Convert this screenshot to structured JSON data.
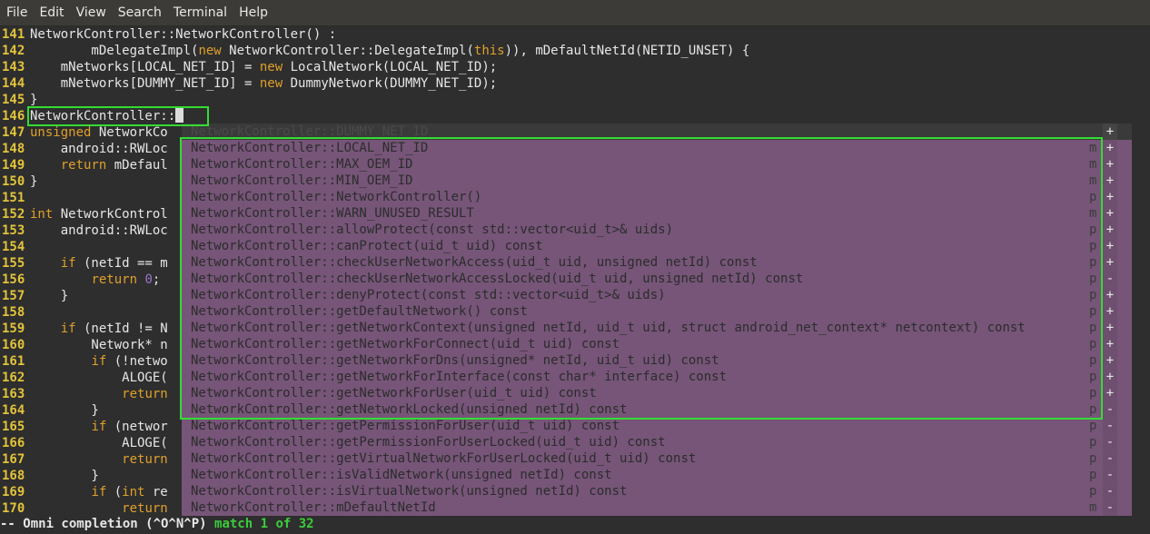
{
  "menubar": [
    "File",
    "Edit",
    "View",
    "Search",
    "Terminal",
    "Help"
  ],
  "lines": [
    {
      "n": "141",
      "segs": [
        {
          "t": "NetworkController::NetworkController() :"
        }
      ]
    },
    {
      "n": "142",
      "segs": [
        {
          "t": "        mDelegateImpl("
        },
        {
          "t": "new",
          "c": "kw"
        },
        {
          "t": " NetworkController::DelegateImpl("
        },
        {
          "t": "this",
          "c": "kw"
        },
        {
          "t": ")), mDefaultNetId(NETID_UNSET) {"
        }
      ]
    },
    {
      "n": "143",
      "segs": [
        {
          "t": "    mNetworks[LOCAL_NET_ID] = "
        },
        {
          "t": "new",
          "c": "kw"
        },
        {
          "t": " LocalNetwork(LOCAL_NET_ID);"
        }
      ]
    },
    {
      "n": "144",
      "segs": [
        {
          "t": "    mNetworks[DUMMY_NET_ID] = "
        },
        {
          "t": "new",
          "c": "kw"
        },
        {
          "t": " DummyNetwork(DUMMY_NET_ID);"
        }
      ]
    },
    {
      "n": "145",
      "segs": [
        {
          "t": "}"
        }
      ]
    },
    {
      "n": "146",
      "segs": [
        {
          "t": "NetworkController::"
        }
      ],
      "cursor": true
    },
    {
      "n": "147",
      "segs": [
        {
          "t": "unsigned",
          "c": "kw"
        },
        {
          "t": " NetworkCo"
        }
      ]
    },
    {
      "n": "148",
      "segs": [
        {
          "t": "    android::RWLoc"
        }
      ]
    },
    {
      "n": "149",
      "segs": [
        {
          "t": "    "
        },
        {
          "t": "return",
          "c": "kw"
        },
        {
          "t": " mDefaul"
        }
      ]
    },
    {
      "n": "150",
      "segs": [
        {
          "t": "}"
        }
      ]
    },
    {
      "n": "151",
      "segs": []
    },
    {
      "n": "152",
      "segs": [
        {
          "t": "int",
          "c": "kw"
        },
        {
          "t": " NetworkControl"
        }
      ]
    },
    {
      "n": "153",
      "segs": [
        {
          "t": "    android::RWLoc"
        }
      ]
    },
    {
      "n": "154",
      "segs": []
    },
    {
      "n": "155",
      "segs": [
        {
          "t": "    "
        },
        {
          "t": "if",
          "c": "kw"
        },
        {
          "t": " (netId == m"
        }
      ]
    },
    {
      "n": "156",
      "segs": [
        {
          "t": "        "
        },
        {
          "t": "return",
          "c": "kw"
        },
        {
          "t": " "
        },
        {
          "t": "0",
          "c": "num"
        },
        {
          "t": ";"
        }
      ]
    },
    {
      "n": "157",
      "segs": [
        {
          "t": "    }"
        }
      ]
    },
    {
      "n": "158",
      "segs": []
    },
    {
      "n": "159",
      "segs": [
        {
          "t": "    "
        },
        {
          "t": "if",
          "c": "kw"
        },
        {
          "t": " (netId != N"
        }
      ]
    },
    {
      "n": "160",
      "segs": [
        {
          "t": "        Network* n"
        }
      ]
    },
    {
      "n": "161",
      "segs": [
        {
          "t": "        "
        },
        {
          "t": "if",
          "c": "kw"
        },
        {
          "t": " (!netwo"
        }
      ]
    },
    {
      "n": "162",
      "segs": [
        {
          "t": "            ALOGE("
        }
      ]
    },
    {
      "n": "163",
      "segs": [
        {
          "t": "            "
        },
        {
          "t": "return",
          "c": "kw"
        }
      ]
    },
    {
      "n": "164",
      "segs": [
        {
          "t": "        }"
        }
      ]
    },
    {
      "n": "165",
      "segs": [
        {
          "t": "        "
        },
        {
          "t": "if",
          "c": "kw"
        },
        {
          "t": " (networ"
        }
      ]
    },
    {
      "n": "166",
      "segs": [
        {
          "t": "            ALOGE("
        }
      ]
    },
    {
      "n": "167",
      "segs": [
        {
          "t": "            "
        },
        {
          "t": "return",
          "c": "kw"
        }
      ]
    },
    {
      "n": "168",
      "segs": [
        {
          "t": "        }"
        }
      ]
    },
    {
      "n": "169",
      "segs": [
        {
          "t": "        "
        },
        {
          "t": "if",
          "c": "kw"
        },
        {
          "t": " ("
        },
        {
          "t": "int",
          "c": "kw"
        },
        {
          "t": " re"
        }
      ]
    },
    {
      "n": "170",
      "segs": [
        {
          "t": "            "
        },
        {
          "t": "return",
          "c": "kw"
        }
      ]
    }
  ],
  "completion": [
    {
      "word": "NetworkController::DUMMY_NET_ID",
      "kind": "m",
      "sb": "+",
      "selected": true
    },
    {
      "word": "NetworkController::LOCAL_NET_ID",
      "kind": "m",
      "sb": "+"
    },
    {
      "word": "NetworkController::MAX_OEM_ID",
      "kind": "m",
      "sb": "+"
    },
    {
      "word": "NetworkController::MIN_OEM_ID",
      "kind": "m",
      "sb": "+"
    },
    {
      "word": "NetworkController::NetworkController()",
      "kind": "p",
      "sb": "+"
    },
    {
      "word": "NetworkController::WARN_UNUSED_RESULT",
      "kind": "m",
      "sb": "+"
    },
    {
      "word": "NetworkController::allowProtect(const std::vector<uid_t>& uids)",
      "kind": "p",
      "sb": "+"
    },
    {
      "word": "NetworkController::canProtect(uid_t uid) const",
      "kind": "p",
      "sb": "+"
    },
    {
      "word": "NetworkController::checkUserNetworkAccess(uid_t uid, unsigned netId) const",
      "kind": "p",
      "sb": "+"
    },
    {
      "word": "NetworkController::checkUserNetworkAccessLocked(uid_t uid, unsigned netId) const",
      "kind": "p",
      "sb": "-"
    },
    {
      "word": "NetworkController::denyProtect(const std::vector<uid_t>& uids)",
      "kind": "p",
      "sb": "+"
    },
    {
      "word": "NetworkController::getDefaultNetwork() const",
      "kind": "p",
      "sb": "+"
    },
    {
      "word": "NetworkController::getNetworkContext(unsigned netId, uid_t uid, struct android_net_context* netcontext) const",
      "kind": "p",
      "sb": "+"
    },
    {
      "word": "NetworkController::getNetworkForConnect(uid_t uid) const",
      "kind": "p",
      "sb": "+"
    },
    {
      "word": "NetworkController::getNetworkForDns(unsigned* netId, uid_t uid) const",
      "kind": "p",
      "sb": "+"
    },
    {
      "word": "NetworkController::getNetworkForInterface(const char* interface) const",
      "kind": "p",
      "sb": "+"
    },
    {
      "word": "NetworkController::getNetworkForUser(uid_t uid) const",
      "kind": "p",
      "sb": "+"
    },
    {
      "word": "NetworkController::getNetworkLocked(unsigned netId) const",
      "kind": "p",
      "sb": "-"
    },
    {
      "word": "NetworkController::getPermissionForUser(uid_t uid) const",
      "kind": "p",
      "sb": "-"
    },
    {
      "word": "NetworkController::getPermissionForUserLocked(uid_t uid) const",
      "kind": "p",
      "sb": "-"
    },
    {
      "word": "NetworkController::getVirtualNetworkForUserLocked(uid_t uid) const",
      "kind": "p",
      "sb": "-"
    },
    {
      "word": "NetworkController::isValidNetwork(unsigned netId) const",
      "kind": "p",
      "sb": "-"
    },
    {
      "word": "NetworkController::isVirtualNetwork(unsigned netId) const",
      "kind": "p",
      "sb": "-"
    },
    {
      "word": "NetworkController::mDefaultNetId",
      "kind": "m",
      "sb": "-"
    }
  ],
  "status": {
    "mode": "-- Omni completion (^O^N^P)",
    "match": "match 1 of 32"
  }
}
